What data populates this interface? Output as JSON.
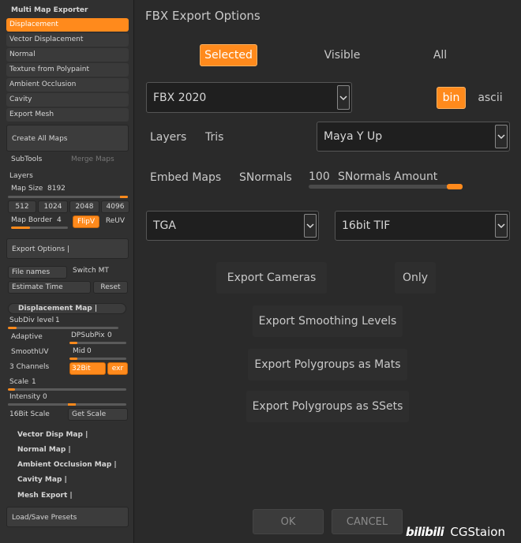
{
  "left": {
    "title": "Multi Map Exporter",
    "rows": [
      "Displacement",
      "Vector Displacement",
      "Normal",
      "Texture from Polypaint",
      "Ambient Occlusion",
      "Cavity",
      "Export Mesh"
    ],
    "create_all_maps": "Create All Maps",
    "subtools": "SubTools",
    "merge_maps": "Merge Maps",
    "layers": "Layers",
    "map_size_label": "Map Size",
    "map_size_value": "8192",
    "sizes": [
      "512",
      "1024",
      "2048",
      "4096"
    ],
    "map_border_label": "Map Border",
    "map_border_value": "4",
    "flipv": "FlipV",
    "reuv": "ReUV",
    "export_options": "Export Options",
    "file_names": "File names",
    "switch_mt": "Switch MT",
    "estimate_time": "Estimate Time",
    "reset": "Reset",
    "displacement_map": "Displacement Map",
    "subdiv_label": "SubDiv level",
    "subdiv_value": "1",
    "adaptive": "Adaptive",
    "dpsubpix_label": "DPSubPix",
    "dpsubpix_value": "0",
    "smoothuv": "SmoothUV",
    "mid_label": "Mid",
    "mid_value": "0",
    "channels": "3 Channels",
    "bit32": "32Bit",
    "exr": "exr",
    "scale_label": "Scale",
    "scale_value": "1",
    "intensity_label": "Intensity",
    "intensity_value": "0",
    "bit16_scale": "16Bit Scale",
    "get_scale": "Get Scale",
    "submaps": [
      "Vector Disp Map",
      "Normal Map",
      "Ambient Occlusion Map",
      "Cavity Map",
      "Mesh Export"
    ],
    "load_save": "Load/Save Presets"
  },
  "main": {
    "title": "FBX Export Options",
    "selected": "Selected",
    "visible": "Visible",
    "all": "All",
    "fbx_version": "FBX 2020",
    "bin": "bin",
    "ascii": "ascii",
    "layers": "Layers",
    "tris": "Tris",
    "up_axis": "Maya Y Up",
    "embed_maps": "Embed Maps",
    "snormals": "SNormals",
    "snormals_amount_value": "100",
    "snormals_amount_label": "SNormals Amount",
    "texture_format": "TGA",
    "bit_format": "16bit TIF",
    "export_cameras": "Export Cameras",
    "only": "Only",
    "export_smoothing": "Export Smoothing Levels",
    "export_polygroups_mats": "Export Polygroups as Mats",
    "export_polygroups_ssets": "Export Polygroups as SSets",
    "ok": "OK",
    "cancel": "CANCEL"
  },
  "watermark": {
    "logo": "bilibili",
    "text": "CGStaion"
  },
  "colors": {
    "accent": "#ff8a1c",
    "panel": "#2a2a2a"
  }
}
